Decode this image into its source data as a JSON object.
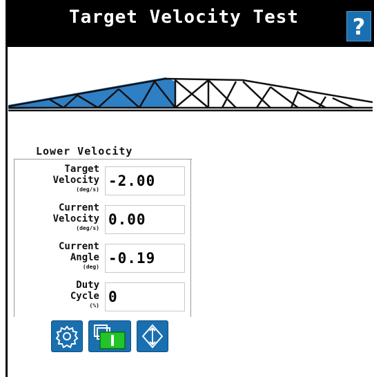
{
  "header": {
    "title": "Target Velocity Test",
    "help_label": "?"
  },
  "section": {
    "title": "Lower Velocity"
  },
  "rows": [
    {
      "label1": "Target",
      "label2": "Velocity",
      "unit": "(deg/s)",
      "value": "-2.00"
    },
    {
      "label1": "Current",
      "label2": "Velocity",
      "unit": "(deg/s)",
      "value": "0.00"
    },
    {
      "label1": "Current",
      "label2": "Angle",
      "unit": "(deg)",
      "value": "-0.19"
    },
    {
      "label1": "Duty",
      "label2": "Cycle",
      "unit": "(%)",
      "value": "0"
    }
  ],
  "buttons": [
    {
      "icon": "gear-icon"
    },
    {
      "icon": "window-toggle-icon"
    },
    {
      "icon": "up-down-arrow-icon"
    }
  ],
  "colors": {
    "header_bg": "#000000",
    "accent_blue": "#1a6fb0",
    "active_green": "#22c42a",
    "boom_highlight": "#2f7fc4"
  }
}
